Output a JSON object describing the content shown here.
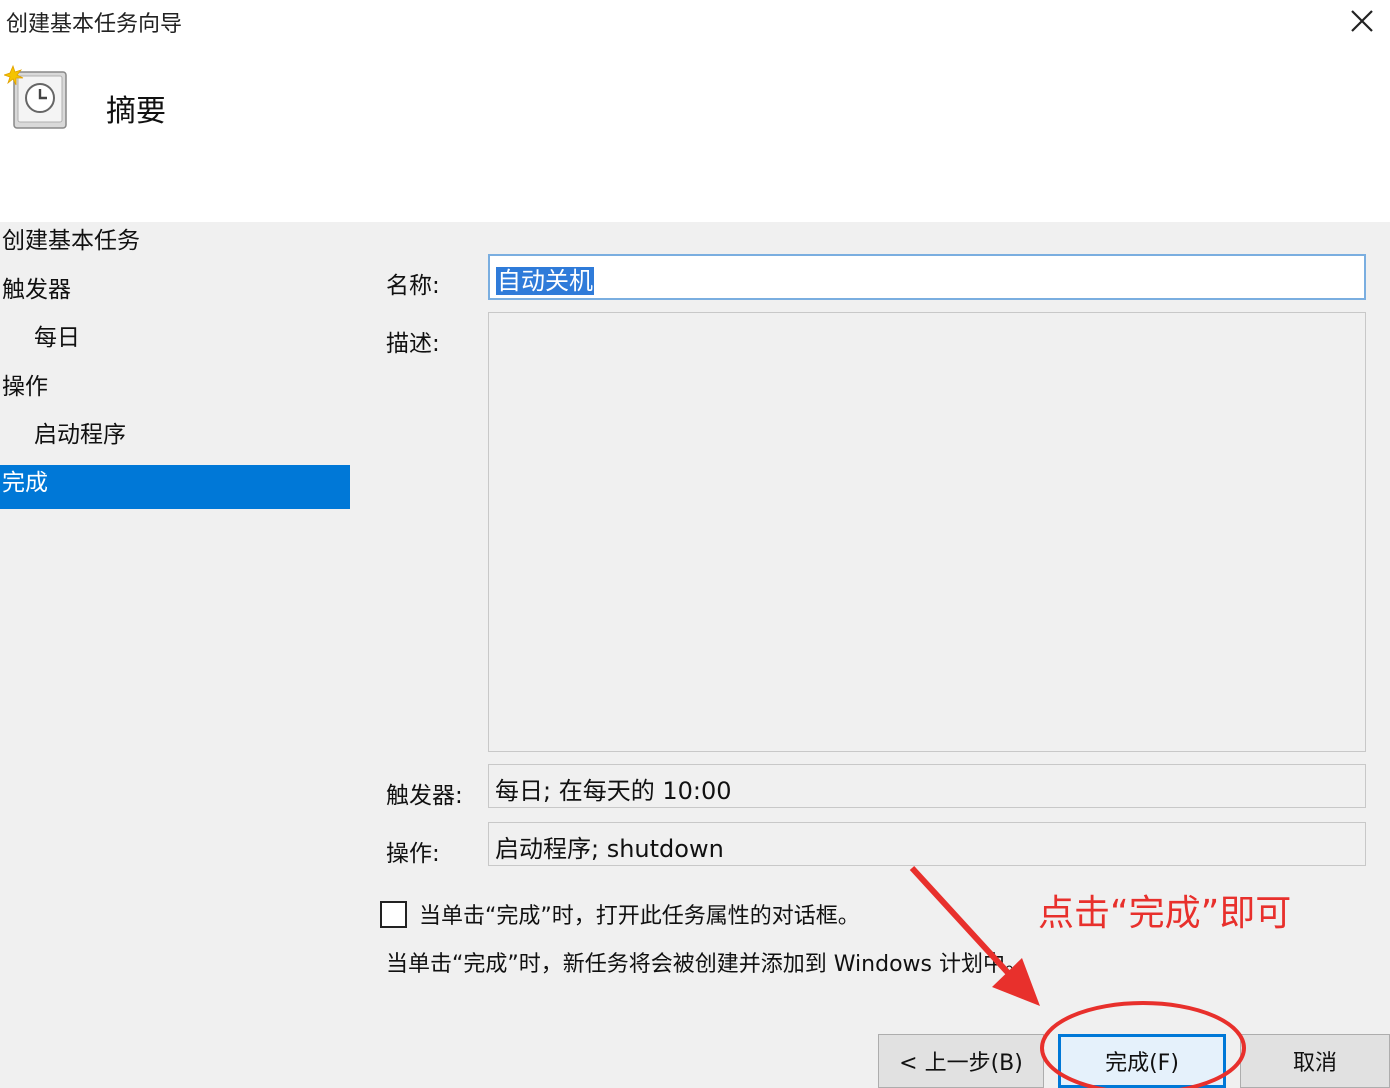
{
  "window": {
    "title": "创建基本任务向导",
    "close_icon": "close-icon"
  },
  "page": {
    "icon": "scheduled-task-clock-icon",
    "heading": "摘要"
  },
  "steps": [
    {
      "label": "创建基本任务",
      "level": 0,
      "active": false
    },
    {
      "label": "触发器",
      "level": 0,
      "active": false
    },
    {
      "label": "每日",
      "level": 1,
      "active": false
    },
    {
      "label": "操作",
      "level": 0,
      "active": false
    },
    {
      "label": "启动程序",
      "level": 1,
      "active": false
    },
    {
      "label": "完成",
      "level": 0,
      "active": true
    }
  ],
  "summary": {
    "name_label": "名称:",
    "name_value": "自动关机",
    "description_label": "描述:",
    "description_value": "",
    "trigger_label": "触发器:",
    "trigger_value": "每日; 在每天的 10:00",
    "action_label": "操作:",
    "action_value": "启动程序; shutdown"
  },
  "options": {
    "open_properties_label": "当单击“完成”时，打开此任务属性的对话框。",
    "open_properties_checked": false,
    "info_text": "当单击“完成”时，新任务将会被创建并添加到 Windows 计划中。"
  },
  "annotation": {
    "text": "点击“完成”即可",
    "color": "#e8302c"
  },
  "buttons": {
    "back": "< 上一步(B)",
    "finish": "完成(F)",
    "cancel": "取消"
  },
  "colors": {
    "accent": "#0078d7",
    "selection": "#2f7bd9"
  }
}
